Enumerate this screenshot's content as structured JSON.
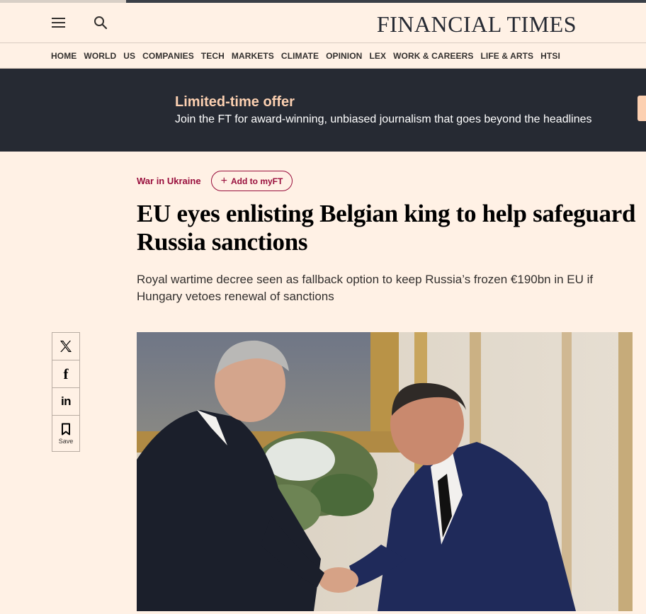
{
  "masthead": {
    "logo": "FINANCIAL TIMES"
  },
  "nav": {
    "items": [
      "HOME",
      "WORLD",
      "US",
      "COMPANIES",
      "TECH",
      "MARKETS",
      "CLIMATE",
      "OPINION",
      "LEX",
      "WORK & CAREERS",
      "LIFE & ARTS",
      "HTSI"
    ]
  },
  "promo": {
    "headline": "Limited-time offer",
    "text": "Join the FT for award-winning, unbiased journalism that goes beyond the headlines"
  },
  "article": {
    "topic": "War in Ukraine",
    "myft_label": "Add to myFT",
    "title": "EU eyes enlisting Belgian king to help safeguard Russia sanctions",
    "standfirst": "Royal wartime decree seen as fallback option to keep Russia’s frozen €190bn in EU if Hungary vetoes renewal of sanctions"
  },
  "share": {
    "save_label": "Save"
  },
  "icons": {
    "menu": "hamburger-icon",
    "search": "search-icon",
    "x": "x-logo-icon",
    "facebook": "facebook-icon",
    "linkedin": "linkedin-icon",
    "bookmark": "bookmark-icon"
  },
  "colors": {
    "background": "#fff1e5",
    "brand_claret": "#990f3d",
    "promo_bg": "#262a33",
    "promo_accent": "#fcd0b1"
  }
}
